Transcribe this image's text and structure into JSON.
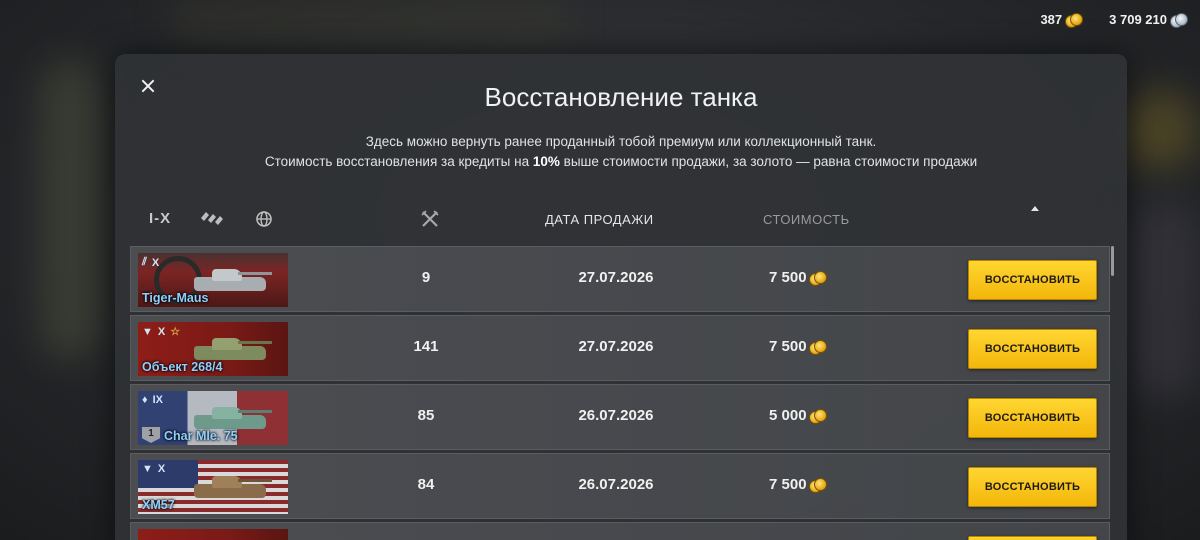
{
  "currency": {
    "gold": "387",
    "credits": "3 709 210"
  },
  "dialog": {
    "title": "Восстановление танка",
    "desc_line1": "Здесь можно вернуть ранее проданный тобой премиум или коллекционный танк.",
    "desc_line2_a": "Стоимость восстановления за кредиты на ",
    "desc_line2_b": "10%",
    "desc_line2_c": " выше стоимости продажи, за золото — равна стоимости продажи"
  },
  "filters": {
    "tier_label": "I-X",
    "type_icon": "vehicle-type-icon",
    "nation_icon": "globe-icon"
  },
  "columns": {
    "battles_icon": "crossed-swords-icon",
    "date": "ДАТА ПРОДАЖИ",
    "cost": "СТОИМОСТЬ"
  },
  "rows": [
    {
      "tier": "X",
      "type_icon": "heavy-tank-icon",
      "name": "Tiger-Maus",
      "nation": "germany",
      "battles": "9",
      "date": "27.07.2026",
      "cost": "7 500",
      "button": "ВОССТАНОВИТЬ"
    },
    {
      "tier": "X",
      "type_icon": "td-icon",
      "name": "Объект 268/4",
      "nation": "ussr",
      "battles": "141",
      "date": "27.07.2026",
      "cost": "7 500",
      "button": "ВОССТАНОВИТЬ"
    },
    {
      "tier": "IX",
      "type_icon": "light-tank-icon",
      "name": "Char Mle. 75",
      "nation": "france",
      "mastery": "1",
      "battles": "85",
      "date": "26.07.2026",
      "cost": "5 000",
      "button": "ВОССТАНОВИТЬ"
    },
    {
      "tier": "X",
      "type_icon": "td-icon",
      "name": "XM57",
      "nation": "usa",
      "battles": "84",
      "date": "26.07.2026",
      "cost": "7 500",
      "button": "ВОССТАНОВИТЬ"
    }
  ],
  "colors": {
    "accent_button": "#f3b60a",
    "tank_name": "#8fd0ff"
  }
}
